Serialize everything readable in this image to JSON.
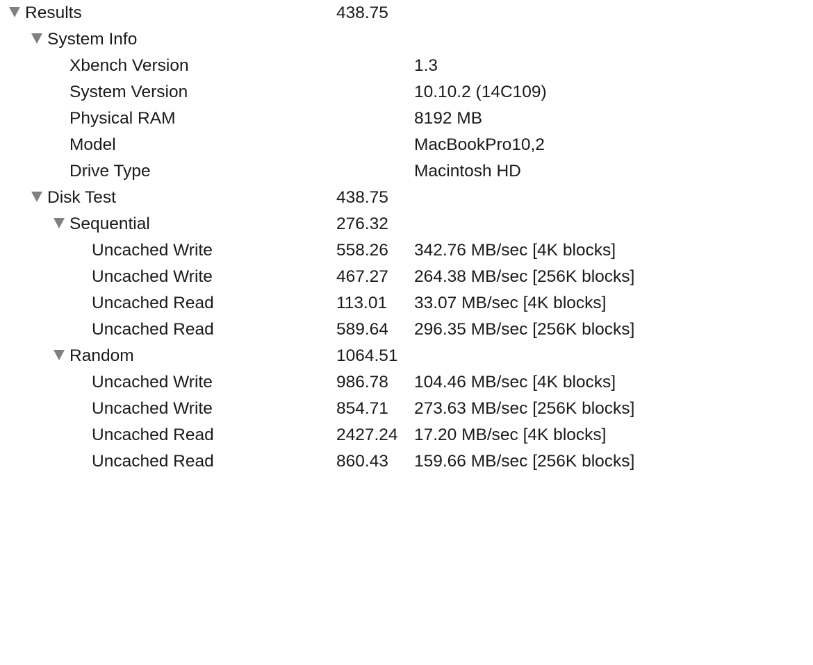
{
  "results": {
    "label": "Results",
    "score": "438.75",
    "disclosure_icon": "triangle-down-icon",
    "children": {
      "system_info": {
        "label": "System Info",
        "disclosure_icon": "triangle-down-icon",
        "items": [
          {
            "label": "Xbench Version",
            "value": "1.3"
          },
          {
            "label": "System Version",
            "value": "10.10.2 (14C109)"
          },
          {
            "label": "Physical RAM",
            "value": "8192 MB"
          },
          {
            "label": "Model",
            "value": "MacBookPro10,2"
          },
          {
            "label": "Drive Type",
            "value": "Macintosh HD"
          }
        ]
      },
      "disk_test": {
        "label": "Disk Test",
        "score": "438.75",
        "disclosure_icon": "triangle-down-icon",
        "sequential": {
          "label": "Sequential",
          "score": "276.32",
          "items": [
            {
              "label": "Uncached Write",
              "score": "558.26",
              "info": "342.76 MB/sec [4K blocks]"
            },
            {
              "label": "Uncached Write",
              "score": "467.27",
              "info": "264.38 MB/sec [256K blocks]"
            },
            {
              "label": "Uncached Read",
              "score": "113.01",
              "info": "33.07 MB/sec [4K blocks]"
            },
            {
              "label": "Uncached Read",
              "score": "589.64",
              "info": "296.35 MB/sec [256K blocks]"
            }
          ]
        },
        "random": {
          "label": "Random",
          "score": "1064.51",
          "items": [
            {
              "label": "Uncached Write",
              "score": "986.78",
              "info": "104.46 MB/sec [4K blocks]"
            },
            {
              "label": "Uncached Write",
              "score": "854.71",
              "info": "273.63 MB/sec [256K blocks]"
            },
            {
              "label": "Uncached Read",
              "score": "2427.24",
              "info": "17.20 MB/sec [4K blocks]"
            },
            {
              "label": "Uncached Read",
              "score": "860.43",
              "info": "159.66 MB/sec [256K blocks]"
            }
          ]
        }
      }
    }
  }
}
